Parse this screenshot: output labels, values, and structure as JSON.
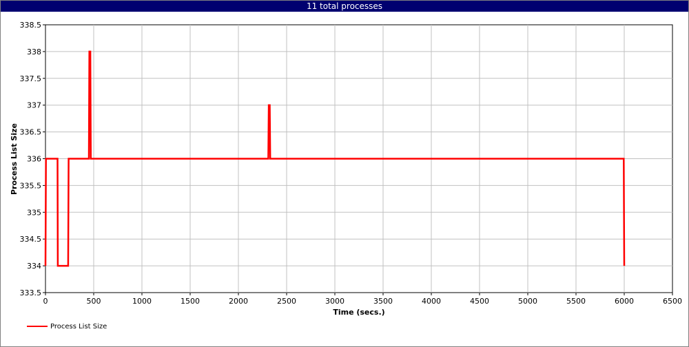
{
  "window": {
    "title": "11 total processes"
  },
  "chart_data": {
    "type": "line",
    "xlabel": "Time (secs.)",
    "ylabel": "Process List Size",
    "xlim": [
      0,
      6500
    ],
    "ylim": [
      333.5,
      338.5
    ],
    "xticks": [
      0,
      500,
      1000,
      1500,
      2000,
      2500,
      3000,
      3500,
      4000,
      4500,
      5000,
      5500,
      6000,
      6500
    ],
    "yticks": [
      333.5,
      334,
      334.5,
      335,
      335.5,
      336,
      336.5,
      337,
      337.5,
      338,
      338.5
    ],
    "grid": true,
    "legend_position": "bottom-left",
    "series": [
      {
        "name": "Process List Size",
        "color": "#ff0000",
        "x": [
          0,
          5,
          125,
          128,
          235,
          240,
          450,
          455,
          465,
          470,
          2310,
          2315,
          2325,
          2330,
          5995,
          6000
        ],
        "y": [
          334,
          336,
          336,
          334,
          334,
          336,
          336,
          338,
          338,
          336,
          336,
          337,
          337,
          336,
          336,
          334
        ]
      }
    ]
  }
}
